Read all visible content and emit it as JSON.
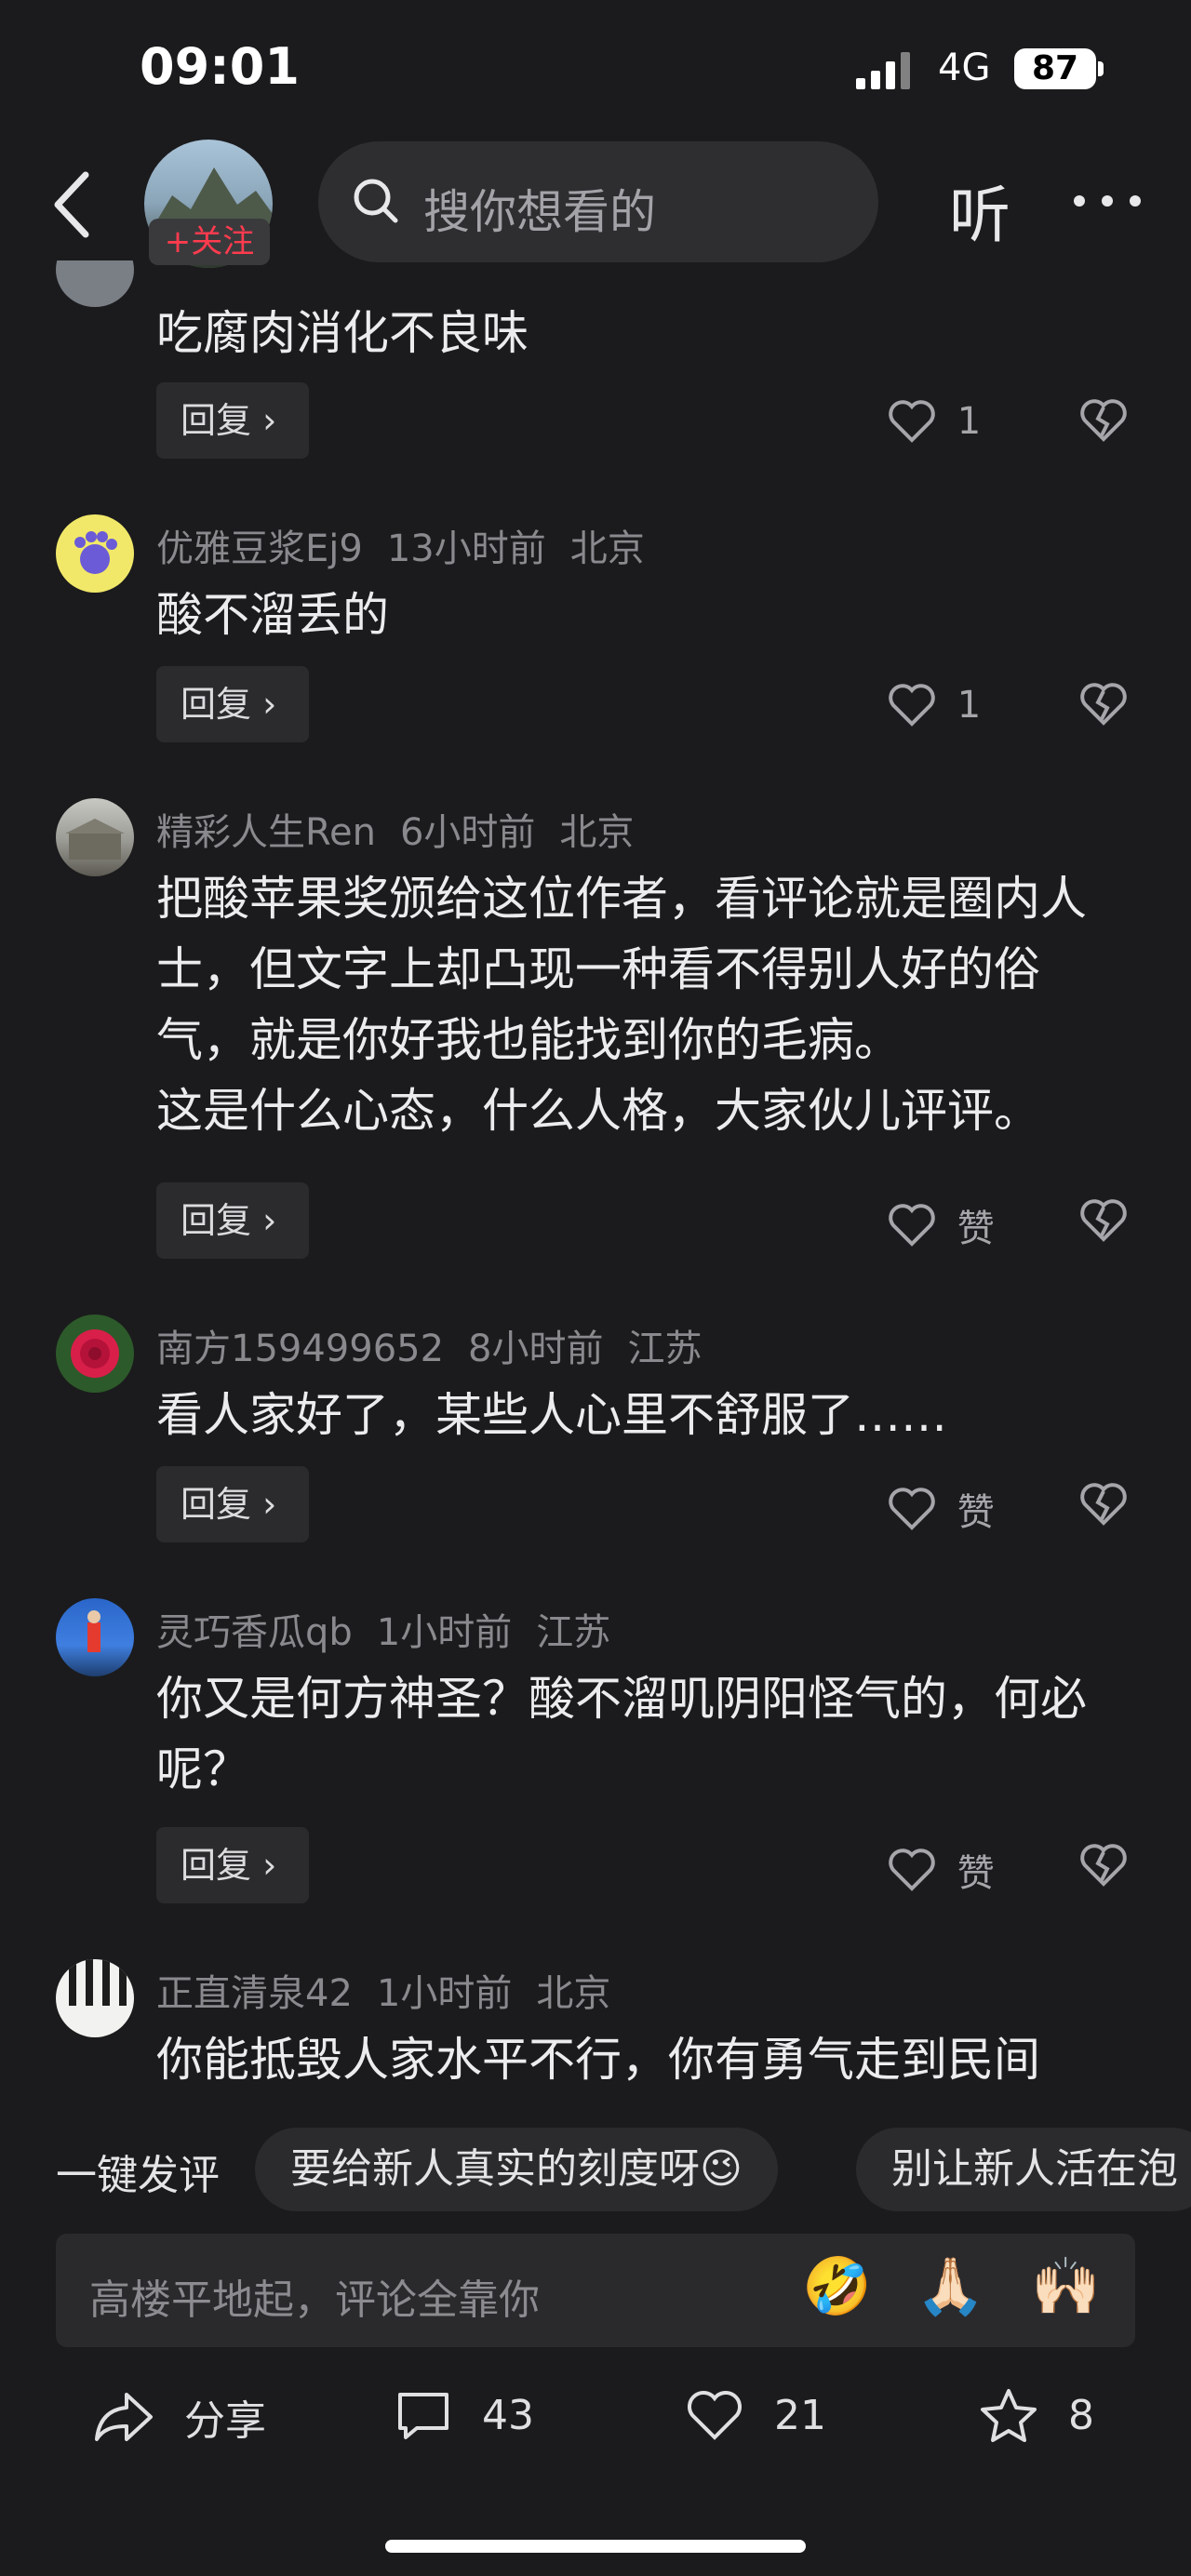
{
  "status": {
    "time": "09:01",
    "network": "4G",
    "battery": "87"
  },
  "header": {
    "follow_badge": "+关注",
    "search_placeholder": "搜你想看的",
    "listen_label": "听"
  },
  "comments": [
    {
      "username": "",
      "time": "",
      "location": "",
      "text": "吃腐肉消化不良味",
      "reply": "回复 ›",
      "likes": "1"
    },
    {
      "username": "优雅豆浆Ej9",
      "time": "13小时前",
      "location": "北京",
      "text": "酸不溜丢的",
      "reply": "回复 ›",
      "likes": "1"
    },
    {
      "username": "精彩人生Ren",
      "time": "6小时前",
      "location": "北京",
      "text": "把酸苹果奖颁给这位作者，看评论就是圈内人士，但文字上却凸现一种看不得别人好的俗气，就是你好我也能找到你的毛病。\n这是什么心态，什么人格，大家伙儿评评。",
      "reply": "回复 ›",
      "likes": "赞"
    },
    {
      "username": "南方159499652",
      "time": "8小时前",
      "location": "江苏",
      "text": "看人家好了，某些人心里不舒服了……",
      "reply": "回复 ›",
      "likes": "赞"
    },
    {
      "username": "灵巧香瓜qb",
      "time": "1小时前",
      "location": "江苏",
      "text": "你又是何方神圣？酸不溜叽阴阳怪气的，何必呢？",
      "reply": "回复 ›",
      "likes": "赞"
    },
    {
      "username": "正直清泉42",
      "time": "1小时前",
      "location": "北京",
      "text": "你能抵毁人家水平不行，你有勇气走到民间",
      "reply": "",
      "likes": ""
    }
  ],
  "quick_comment": {
    "label": "一键发评",
    "chips": [
      "要给新人真实的刻度呀😉",
      "别让新人活在泡"
    ]
  },
  "input": {
    "placeholder": "高楼平地起，评论全靠你",
    "emojis": [
      "🤣",
      "🙏🏻",
      "🙌🏻"
    ]
  },
  "bottom_bar": {
    "share": "分享",
    "comments": "43",
    "likes": "21",
    "favorites": "8"
  },
  "colors": {
    "background": "#1b1b1d",
    "accent": "#ff3b4e"
  }
}
